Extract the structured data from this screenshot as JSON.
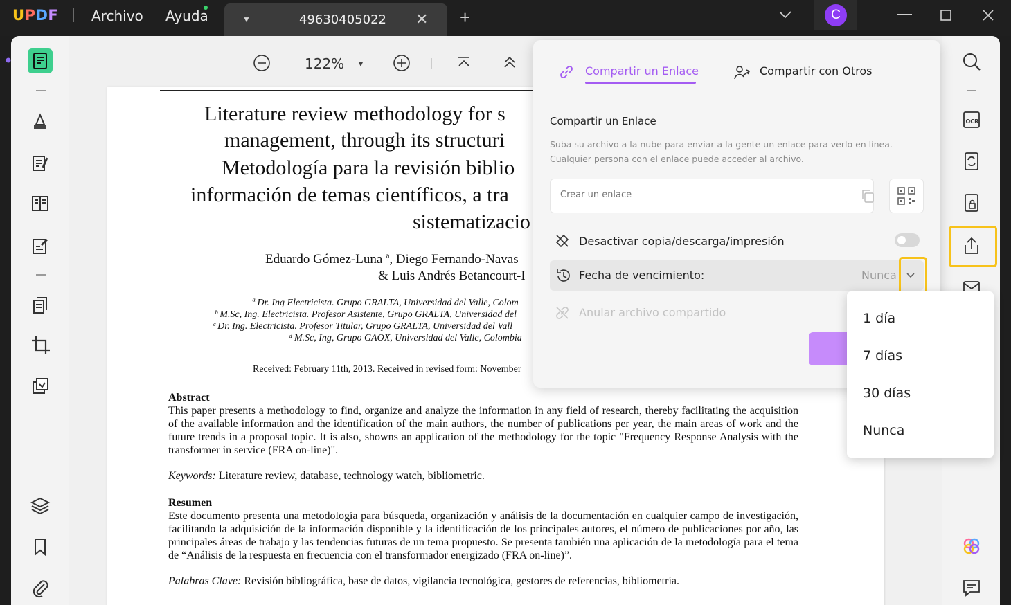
{
  "app": {
    "logo": "UPDF",
    "menu_file": "Archivo",
    "menu_help": "Ayuda"
  },
  "tab": {
    "title": "49630405022",
    "close": "✕",
    "add": "+"
  },
  "user": {
    "avatar_letter": "C",
    "avatar_color": "#8e3df5"
  },
  "window": {
    "chevron": "⌄",
    "minimize": "—",
    "maximize": "☐",
    "close": "✕"
  },
  "toolbar": {
    "zoom": "122%"
  },
  "document": {
    "title_lines": [
      "Literature review methodology for s",
      "management, through its structuri",
      "Metodología para la revisión biblio",
      "información de temas científicos, a tra",
      "sistematizacio"
    ],
    "authors_line1": "Eduardo Gómez-Luna ª, Diego Fernando-Navas",
    "authors_line2": "& Luis Andrés Betancourt-I",
    "affiliations": [
      "ª Dr. Ing Electricista. Grupo GRALTA, Universidad del Valle, Colom",
      "ᵇ M.Sc, Ing. Electricista. Profesor Asistente, Grupo GRALTA, Universidad del",
      "ᶜ Dr. Ing. Electricista. Profesor Titular, Grupo GRALTA, Universidad del Vall",
      "ᵈ M.Sc, Ing, Grupo GAOX, Universidad del Valle, Colombia"
    ],
    "received": "Received: February 11th, 2013. Received in revised form: November",
    "abstract_heading": "Abstract",
    "abstract_text": "This paper presents a methodology to find, organize and analyze the information in any field of research, thereby facilitating the acquisition of the available information and the identification of the main authors, the number of publications per year, the main areas of work and the future trends in a proposal topic. It is also, showns an application of the methodology for the topic \"Frequency Response Analysis with the transformer in service (FRA on-line)\".",
    "keywords_label": "Keywords:",
    "keywords_text": " Literature review, database, technology watch, bibliometric.",
    "resumen_heading": "Resumen",
    "resumen_text": "Este documento presenta una metodología para búsqueda, organización y análisis de la documentación en cualquier campo de investigación, facilitando la adquisición de la información disponible y la identificación de los principales autores, el número de publicaciones por año, las principales áreas de trabajo y las tendencias futuras de un tema propuesto. Se presenta también una aplicación de la metodología para el tema de “Análisis de la respuesta en frecuencia con el transformador energizado (FRA on-line)”.",
    "palabras_label": "Palabras Clave:",
    "palabras_text": " Revisión bibliográfica, base de datos, vigilancia tecnológica, gestores de referencias, bibliometría."
  },
  "share_panel": {
    "tab_link": "Compartir un Enlace",
    "tab_others": "Compartir con Otros",
    "heading": "Compartir un Enlace",
    "description": "Suba su archivo a la nube para enviar a la gente un enlace para verlo en línea. Cualquier persona con el enlace puede acceder al archivo.",
    "link_placeholder": "Crear un enlace",
    "disable_copy_label": "Desactivar copia/descarga/impresión",
    "expiry_label": "Fecha de vencimiento:",
    "expiry_value": "Nunca",
    "revoke_label": "Anular archivo compartido",
    "accent_color": "#a45cf2"
  },
  "expiry_dropdown": {
    "options": [
      "1 día",
      "7 días",
      "30 días",
      "Nunca"
    ]
  },
  "highlight_color": "#f7c21a"
}
